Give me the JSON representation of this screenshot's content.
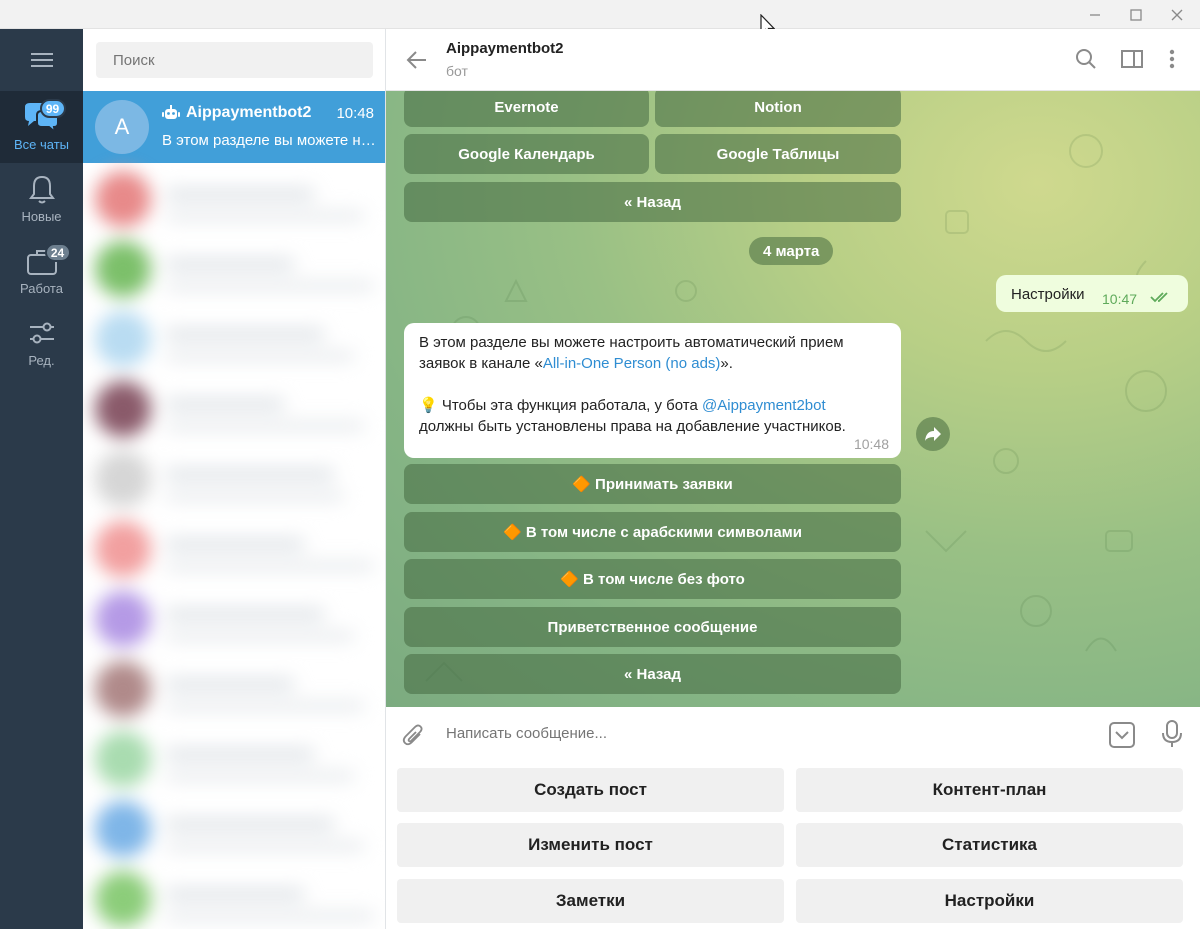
{
  "window": {
    "controls": [
      "minimize",
      "maximize",
      "close"
    ]
  },
  "rail": {
    "items": [
      {
        "label": "Все чаты",
        "badge": "99",
        "active": true,
        "icon": "chats-icon"
      },
      {
        "label": "Новые",
        "badge": "",
        "active": false,
        "icon": "bell-icon"
      },
      {
        "label": "Работа",
        "badge": "24",
        "active": false,
        "icon": "briefcase-icon"
      },
      {
        "label": "Ред.",
        "badge": "",
        "active": false,
        "icon": "sliders-icon"
      }
    ]
  },
  "chatlist": {
    "search_placeholder": "Поиск",
    "active_chat": {
      "avatar_letter": "A",
      "name": "Aippaymentbot2",
      "time": "10:48",
      "preview": "В этом разделе вы можете настроить автоматический прием заявок"
    }
  },
  "header": {
    "title": "Aippaymentbot2",
    "subtitle": "бот"
  },
  "messages": {
    "top_buttons": [
      [
        "Evernote",
        "Notion"
      ],
      [
        "Google Календарь",
        "Google Таблицы"
      ],
      [
        "« Назад"
      ]
    ],
    "date_label": "4 марта",
    "outgoing": {
      "text": "Настройки",
      "time": "10:47"
    },
    "incoming": {
      "line1": "В этом разделе вы можете настроить автоматический прием",
      "line2_prefix": "заявок в канале «",
      "line2_link": "All-in-One Person (no ads)",
      "line2_suffix": "».",
      "line3_prefix": "💡 Чтобы эта функция работала, у бота ",
      "line3_link": "@Aippayment2bot",
      "line4": "должны быть установлены права на добавление участников.",
      "time": "10:48"
    },
    "inline_buttons": [
      "🔶 Принимать заявки",
      "🔶 В том числе с арабскими символами",
      "🔶 В том числе без фото",
      "Приветственное сообщение",
      "« Назад"
    ]
  },
  "composer": {
    "placeholder": "Написать сообщение..."
  },
  "reply_keyboard": [
    [
      "Создать пост",
      "Контент-план"
    ],
    [
      "Изменить пост",
      "Статистика"
    ],
    [
      "Заметки",
      "Настройки"
    ]
  ],
  "colors": {
    "accent": "#419fd9",
    "rail_bg": "#2b3a4a",
    "outgoing_bubble": "#effdde"
  }
}
